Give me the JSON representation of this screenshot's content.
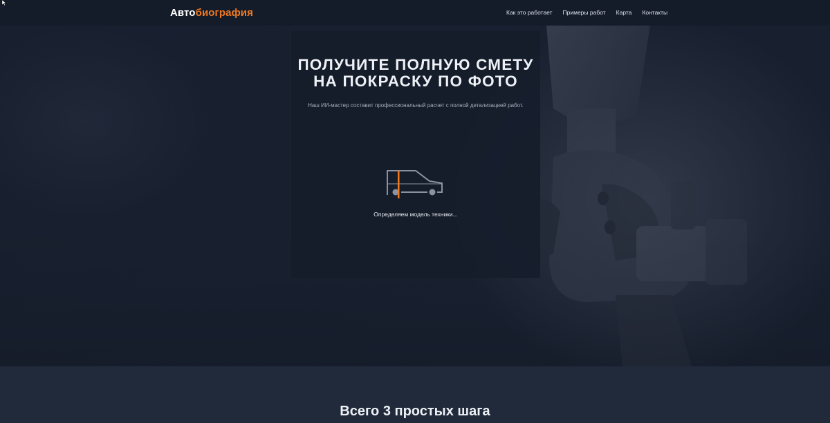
{
  "header": {
    "logo_part1": "Авто",
    "logo_part2": "биография",
    "nav": [
      {
        "label": "Как это работает"
      },
      {
        "label": "Примеры работ"
      },
      {
        "label": "Карта"
      },
      {
        "label": "Контакты"
      }
    ]
  },
  "hero": {
    "title": "ПОЛУЧИТЕ ПОЛНУЮ СМЕТУ НА ПОКРАСКУ ПО ФОТО",
    "subtitle": "Наш ИИ-мастер составит профессиональный расчет с полной детализацией работ.",
    "status": "Определяем модель техники...",
    "icon": "car-scan-icon"
  },
  "steps": {
    "title": "Всего 3 простых шага"
  },
  "colors": {
    "accent": "#f07a22",
    "background": "#161d2b",
    "section": "#202a3a"
  }
}
